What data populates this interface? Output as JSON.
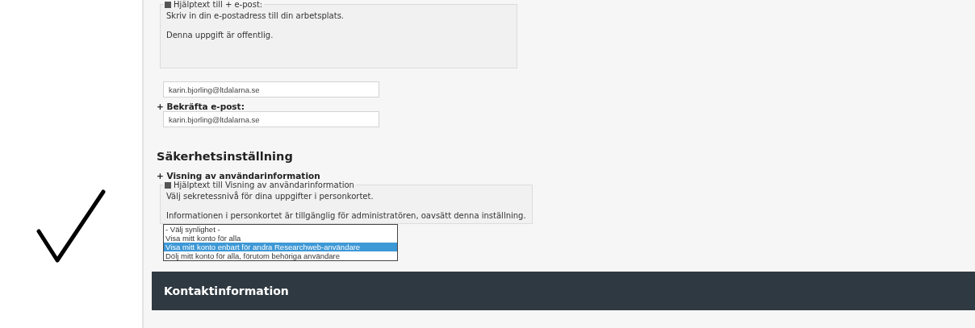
{
  "email_help": {
    "legend": "Hjälptext till + e-post:",
    "paragraphs": [
      "Skriv in din e-postadress till din arbetsplats.",
      "Denna uppgift är offentlig."
    ]
  },
  "email": {
    "value": "karin.bjorling@ltdalarna.se"
  },
  "confirm_email": {
    "label": "+ Bekräfta e-post:",
    "value": "karin.bjorling@ltdalarna.se"
  },
  "security": {
    "heading": "Säkerhetsinställning",
    "field_label": "+ Visning av användarinformation",
    "help": {
      "legend": "Hjälptext till Visning av användarinformation",
      "paragraphs": [
        "Välj sekretessnivå för dina uppgifter i personkortet.",
        "Informationen i personkortet är tillgänglig för administratören, oavsätt denna inställning."
      ]
    },
    "options": [
      {
        "label": "- Välj synlighet -",
        "selected": false
      },
      {
        "label": "Visa mitt konto för alla",
        "selected": false
      },
      {
        "label": "Visa mitt konto enbart för andra Researchweb-användare",
        "selected": true
      },
      {
        "label": "Dölj mitt konto för alla, förutom behöriga användare",
        "selected": false
      }
    ]
  },
  "section_bar": {
    "title": "Kontaktinformation"
  }
}
